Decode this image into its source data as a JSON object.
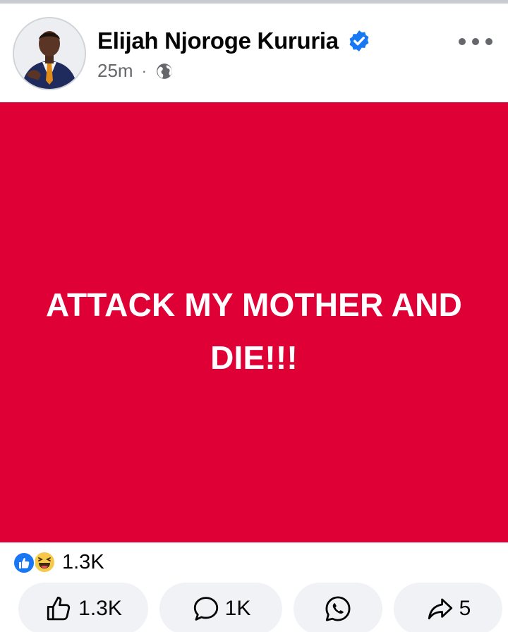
{
  "post": {
    "author": "Elijah Njoroge Kururia",
    "verified": true,
    "time": "25m",
    "separator": "·",
    "audience_icon": "globe-icon",
    "text": "ATTACK MY MOTHER AND DIE!!!",
    "background_color": "#df0036"
  },
  "reactions": {
    "icons": [
      "like-reaction-icon",
      "haha-reaction-icon"
    ],
    "count": "1.3K"
  },
  "actions": {
    "like_count": "1.3K",
    "comment_count": "1K",
    "share_count": "5"
  },
  "colors": {
    "accent": "#1877f2",
    "meta_text": "#65676b",
    "button_bg": "#f0f2f5"
  }
}
